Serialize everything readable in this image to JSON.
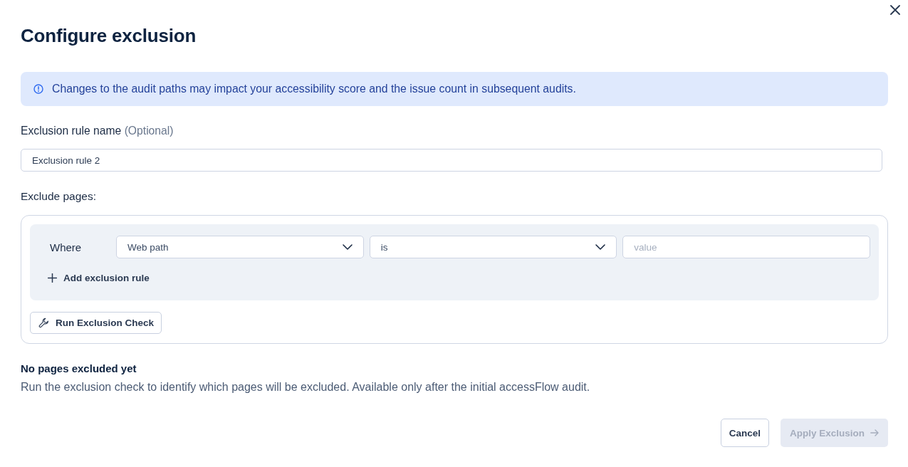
{
  "dialog": {
    "title": "Configure exclusion"
  },
  "notice": {
    "text": "Changes to the audit paths may impact your accessibility score and the issue count in subsequent audits."
  },
  "rule_name": {
    "label": "Exclusion rule name",
    "hint": "(Optional)",
    "value": "Exclusion rule 2"
  },
  "exclude_pages": {
    "label": "Exclude pages:",
    "conditions": [
      {
        "prefix": "Where",
        "field": "Web path",
        "operator": "is",
        "placeholder": "value"
      }
    ],
    "add_rule": "Add exclusion rule",
    "check_button": "Run Exclusion Check"
  },
  "result": {
    "title": "No pages excluded yet",
    "description": "Run the exclusion check to identify which pages will be excluded. Available only after the initial accessFlow audit."
  },
  "buttons": [
    {
      "label": "Cancel",
      "kind": "secondary",
      "disabled": false
    },
    {
      "label": "Apply Exclusion",
      "kind": "primary",
      "disabled": true
    }
  ]
}
